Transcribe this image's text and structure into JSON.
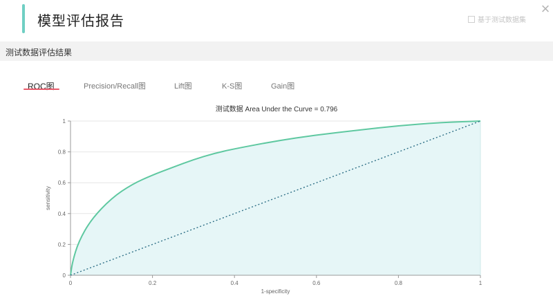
{
  "header": {
    "title": "模型评估报告",
    "link_text": "基于测试数据集"
  },
  "section": {
    "title": "测试数据评估结果"
  },
  "tabs": [
    {
      "label": "ROC图",
      "active": true
    },
    {
      "label": "Precision/Recall图",
      "active": false
    },
    {
      "label": "Lift图",
      "active": false
    },
    {
      "label": "K-S图",
      "active": false
    },
    {
      "label": "Gain图",
      "active": false
    }
  ],
  "colors": {
    "accent": "#6fcfc3",
    "curve": "#5ec8a0",
    "area": "#e6f6f7",
    "diagonal": "#2e6f86",
    "tab_underline": "#e85a6a"
  },
  "icons": {
    "close": "close-icon",
    "checkbox": "checkbox-icon"
  },
  "chart_data": {
    "type": "line",
    "title": "测试数据 Area Under the Curve = 0.796",
    "xlabel": "1-specificity",
    "ylabel": "sensitivity",
    "xlim": [
      0,
      1
    ],
    "ylim": [
      0,
      1
    ],
    "x_ticks": [
      "0",
      "0.2",
      "0.4",
      "0.6",
      "0.8",
      "1"
    ],
    "y_ticks": [
      "0",
      "0.2",
      "0.4",
      "0.6",
      "0.8",
      "1"
    ],
    "grid": true,
    "series": [
      {
        "style": "solid",
        "x": [
          0,
          0.005,
          0.02,
          0.05,
          0.1,
          0.15,
          0.2,
          0.25,
          0.3,
          0.35,
          0.4,
          0.5,
          0.6,
          0.7,
          0.8,
          0.9,
          1.0
        ],
        "y": [
          0,
          0.09,
          0.22,
          0.36,
          0.5,
          0.59,
          0.65,
          0.7,
          0.75,
          0.79,
          0.82,
          0.87,
          0.91,
          0.94,
          0.97,
          0.99,
          1.0
        ]
      },
      {
        "style": "dotted",
        "x": [
          0,
          1
        ],
        "y": [
          0,
          1
        ]
      }
    ]
  }
}
